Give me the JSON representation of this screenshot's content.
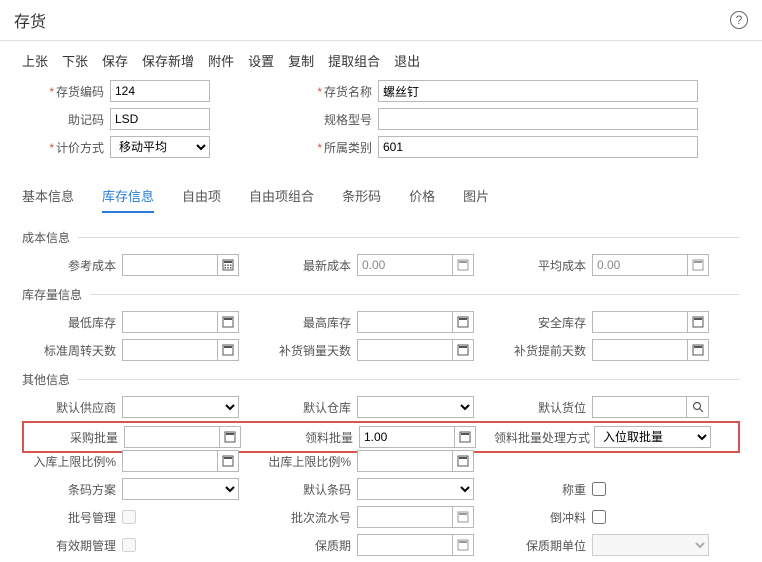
{
  "header": {
    "title": "存货"
  },
  "toolbar": [
    "上张",
    "下张",
    "保存",
    "保存新增",
    "附件",
    "设置",
    "复制",
    "提取组合",
    "退出"
  ],
  "top": {
    "code_label": "存货编码",
    "code_value": "124",
    "name_label": "存货名称",
    "name_value": "螺丝钉",
    "mnemonic_label": "助记码",
    "mnemonic_value": "LSD",
    "spec_label": "规格型号",
    "spec_value": "",
    "cost_method_label": "计价方式",
    "cost_method_value": "移动平均",
    "category_label": "所属类别",
    "category_value": "601"
  },
  "tabs": [
    "基本信息",
    "库存信息",
    "自由项",
    "自由项组合",
    "条形码",
    "价格",
    "图片"
  ],
  "activeTab": 1,
  "sections": {
    "cost": {
      "title": "成本信息",
      "ref_cost": "参考成本",
      "ref_cost_val": "",
      "latest_cost": "最新成本",
      "latest_cost_val": "0.00",
      "avg_cost": "平均成本",
      "avg_cost_val": "0.00"
    },
    "stock": {
      "title": "库存量信息",
      "min": "最低库存",
      "min_val": "",
      "max": "最高库存",
      "max_val": "",
      "safety": "安全库存",
      "safety_val": "",
      "turnover": "标准周转天数",
      "turnover_val": "",
      "replenish_sales": "补货销量天数",
      "replenish_sales_val": "",
      "replenish_lead": "补货提前天数",
      "replenish_lead_val": ""
    },
    "other": {
      "title": "其他信息",
      "supplier": "默认供应商",
      "warehouse": "默认仓库",
      "location": "默认货位",
      "purchase_batch": "采购批量",
      "purchase_batch_val": "",
      "issue_batch": "领料批量",
      "issue_batch_val": "1.00",
      "issue_method": "领料批量处理方式",
      "issue_method_val": "入位取批量",
      "in_upper": "入库上限比例%",
      "in_upper_val": "",
      "out_upper": "出库上限比例%",
      "out_upper_val": "",
      "barcode_scheme": "条码方案",
      "default_barcode": "默认条码",
      "weigh": "称重",
      "batch_mgmt": "批号管理",
      "batch_serial": "批次流水号",
      "reverse": "倒冲料",
      "expiry_mgmt": "有效期管理",
      "shelf_life": "保质期",
      "shelf_unit": "保质期单位"
    }
  }
}
